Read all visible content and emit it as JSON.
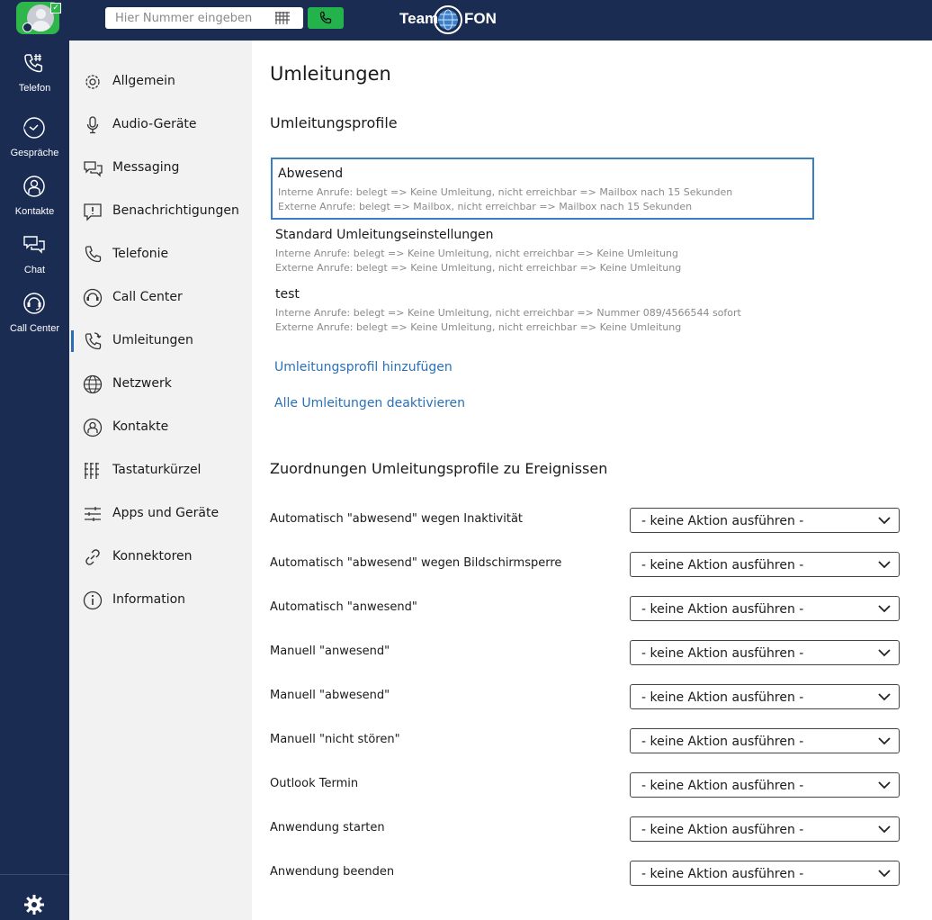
{
  "top": {
    "search_placeholder": "Hier Nummer eingeben",
    "logo_left": "Team",
    "logo_right": "FON"
  },
  "rail": [
    {
      "label": "Telefon",
      "icon": "phone-hash-icon"
    },
    {
      "label": "Gespräche",
      "icon": "clock-history-icon"
    },
    {
      "label": "Kontakte",
      "icon": "contact-icon"
    },
    {
      "label": "Chat",
      "icon": "chat-icon"
    },
    {
      "label": "Call Center",
      "icon": "headset-icon"
    }
  ],
  "nav": [
    {
      "label": "Allgemein",
      "icon": "gear-icon",
      "active": false
    },
    {
      "label": "Audio-Geräte",
      "icon": "microphone-icon",
      "active": false
    },
    {
      "label": "Messaging",
      "icon": "messaging-icon",
      "active": false
    },
    {
      "label": "Benachrichtigungen",
      "icon": "notification-icon",
      "active": false
    },
    {
      "label": "Telefonie",
      "icon": "phone-icon",
      "active": false
    },
    {
      "label": "Call Center",
      "icon": "headset-icon",
      "active": false
    },
    {
      "label": "Umleitungen",
      "icon": "call-forward-icon",
      "active": true
    },
    {
      "label": "Netzwerk",
      "icon": "network-globe-icon",
      "active": false
    },
    {
      "label": "Kontakte",
      "icon": "contact-icon",
      "active": false
    },
    {
      "label": "Tastaturkürzel",
      "icon": "keypad-icon",
      "active": false
    },
    {
      "label": "Apps und Geräte",
      "icon": "sliders-icon",
      "active": false
    },
    {
      "label": "Konnektoren",
      "icon": "link-icon",
      "active": false
    },
    {
      "label": "Information",
      "icon": "info-icon",
      "active": false
    }
  ],
  "main": {
    "title": "Umleitungen",
    "profiles_title": "Umleitungsprofile",
    "profiles": [
      {
        "name": "Abwesend",
        "internal": "Interne Anrufe: belegt => Keine Umleitung, nicht erreichbar => Mailbox nach 15 Sekunden",
        "external": "Externe Anrufe: belegt => Mailbox, nicht erreichbar => Mailbox nach 15 Sekunden",
        "selected": true
      },
      {
        "name": "Standard Umleitungseinstellungen",
        "internal": "Interne Anrufe: belegt => Keine Umleitung, nicht erreichbar => Keine Umleitung",
        "external": "Externe Anrufe: belegt => Keine Umleitung, nicht erreichbar => Keine Umleitung",
        "selected": false
      },
      {
        "name": "test",
        "internal": "Interne Anrufe: belegt => Keine Umleitung, nicht erreichbar => Nummer 089/4566544 sofort",
        "external": "Externe Anrufe: belegt => Keine Umleitung, nicht erreichbar => Keine Umleitung",
        "selected": false
      }
    ],
    "add_profile_link": "Umleitungsprofil hinzufügen",
    "deactivate_all_link": "Alle Umleitungen deaktivieren",
    "mapping_title": "Zuordnungen Umleitungsprofile zu Ereignissen",
    "mappings": [
      {
        "label": "Automatisch \"abwesend\" wegen Inaktivität",
        "value": "- keine Aktion ausführen -"
      },
      {
        "label": "Automatisch \"abwesend\" wegen Bildschirmsperre",
        "value": "- keine Aktion ausführen -"
      },
      {
        "label": "Automatisch \"anwesend\"",
        "value": "- keine Aktion ausführen -"
      },
      {
        "label": "Manuell \"anwesend\"",
        "value": "- keine Aktion ausführen -"
      },
      {
        "label": "Manuell \"abwesend\"",
        "value": "- keine Aktion ausführen -"
      },
      {
        "label": "Manuell \"nicht stören\"",
        "value": "- keine Aktion ausführen -"
      },
      {
        "label": "Outlook Termin",
        "value": "- keine Aktion ausführen -"
      },
      {
        "label": "Anwendung starten",
        "value": "- keine Aktion ausführen -"
      },
      {
        "label": "Anwendung beenden",
        "value": "- keine Aktion ausführen -"
      }
    ]
  },
  "colors": {
    "navy": "#1b2c53",
    "green": "#23b24b",
    "link": "#2a70b8",
    "selected_border": "#3a7fc1"
  }
}
